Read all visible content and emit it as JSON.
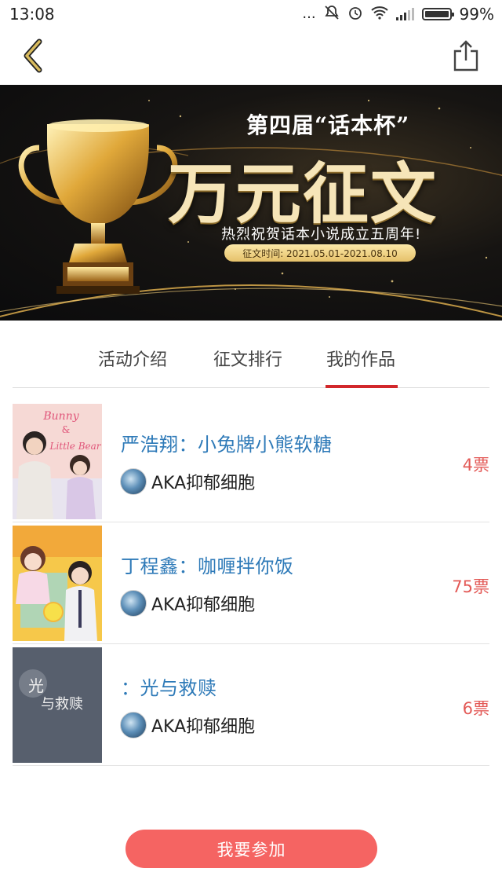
{
  "status_bar": {
    "time": "13:08",
    "dots": "...",
    "battery": "99%"
  },
  "nav": {
    "back_icon": "chevron-left-icon",
    "share_icon": "share-icon",
    "accent": "#d4b25a"
  },
  "banner": {
    "edition": "第四届“话本杯”",
    "main_title": "万元征文",
    "subtitle": "热烈祝贺话本小说成立五周年!",
    "date": "征文时间: 2021.05.01-2021.08.10"
  },
  "tabs": [
    {
      "label": "活动介绍"
    },
    {
      "label": "征文排行"
    },
    {
      "label": "我的作品",
      "active": true
    }
  ],
  "works": [
    {
      "title": "严浩翔：小兔牌小熊软糖",
      "author": "AKA抑郁细胞",
      "votes": "4票",
      "cover_text": [
        "Bunny",
        "&",
        "Little Bear"
      ]
    },
    {
      "title": "丁程鑫：咖喱拌你饭",
      "author": "AKA抑郁细胞",
      "votes": "75票"
    },
    {
      "title": "：光与救赎",
      "author": "AKA抑郁细胞",
      "votes": "6票",
      "cover_text": [
        "光",
        "与救赎"
      ]
    }
  ],
  "join_button": "我要参加",
  "colors": {
    "tab_underline": "#d2282b",
    "title_blue": "#2e7ab8",
    "votes_red": "#e35a57",
    "button_bg": "#f56462"
  }
}
